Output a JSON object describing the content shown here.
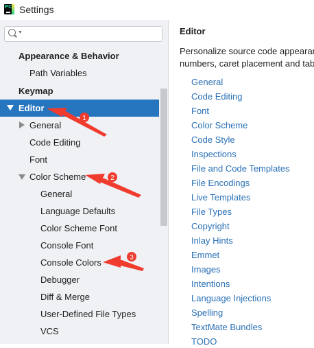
{
  "window": {
    "title": "Settings",
    "logo_text": "PC"
  },
  "search": {
    "value": "",
    "placeholder": ""
  },
  "sidebar": {
    "items": [
      {
        "label": "Appearance & Behavior"
      },
      {
        "label": "Path Variables"
      },
      {
        "label": "Keymap"
      },
      {
        "label": "Editor"
      },
      {
        "label": "General"
      },
      {
        "label": "Code Editing"
      },
      {
        "label": "Font"
      },
      {
        "label": "Color Scheme"
      },
      {
        "label": "General"
      },
      {
        "label": "Language Defaults"
      },
      {
        "label": "Color Scheme Font"
      },
      {
        "label": "Console Font"
      },
      {
        "label": "Console Colors"
      },
      {
        "label": "Debugger"
      },
      {
        "label": "Diff & Merge"
      },
      {
        "label": "User-Defined File Types"
      },
      {
        "label": "VCS"
      }
    ],
    "selected": "Editor"
  },
  "main": {
    "title": "Editor",
    "description_line1": "Personalize source code appearan",
    "description_line2": "numbers, caret placement and tab",
    "links": [
      "General",
      "Code Editing",
      "Font",
      "Color Scheme",
      "Code Style",
      "Inspections",
      "File and Code Templates",
      "File Encodings",
      "Live Templates",
      "File Types",
      "Copyright",
      "Inlay Hints",
      "Emmet",
      "Images",
      "Intentions",
      "Language Injections",
      "Spelling",
      "TextMate Bundles",
      "TODO"
    ]
  },
  "annotations": {
    "marker1": "1",
    "marker2": "2",
    "marker3": "3",
    "color": "#f03c2e"
  },
  "colors": {
    "selection": "#2675bf",
    "link": "#2970b6",
    "sidebar_bg": "#f0f1f4"
  }
}
